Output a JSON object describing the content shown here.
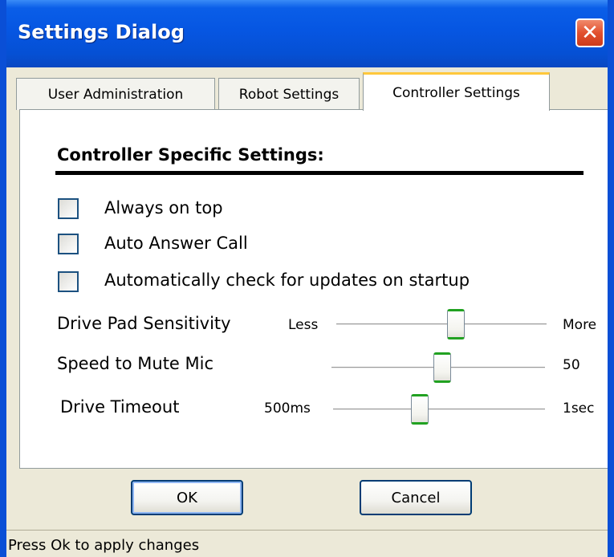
{
  "window": {
    "title": "Settings Dialog",
    "close_glyph": "✕"
  },
  "tabs": [
    {
      "label": "User Administration",
      "active": false
    },
    {
      "label": "Robot Settings",
      "active": false
    },
    {
      "label": "Controller Settings",
      "active": true
    }
  ],
  "panel": {
    "heading": "Controller Specific Settings:",
    "checkboxes": [
      {
        "label": "Always on top",
        "checked": false
      },
      {
        "label": "Auto Answer Call",
        "checked": false
      },
      {
        "label": "Automatically check for updates on startup",
        "checked": false
      }
    ],
    "sliders": [
      {
        "label": "Drive Pad Sensitivity",
        "min_label": "Less",
        "max_label": "More",
        "level": 0.57
      },
      {
        "label": "Speed to Mute Mic",
        "min_label": "",
        "max_label": "50",
        "level": 0.52
      },
      {
        "label": "Drive Timeout",
        "min_label": "500ms",
        "max_label": "1sec",
        "level": 0.41
      }
    ]
  },
  "buttons": {
    "ok_label": "OK",
    "cancel_label": "Cancel"
  },
  "status": {
    "text": "Press Ok to apply changes"
  },
  "colors": {
    "title_bar": "#0656e2",
    "close_button": "#e2502e",
    "active_tab_accent": "#ffc83c",
    "slider_thumb_accent": "#21a121",
    "button_border": "#003c74"
  }
}
